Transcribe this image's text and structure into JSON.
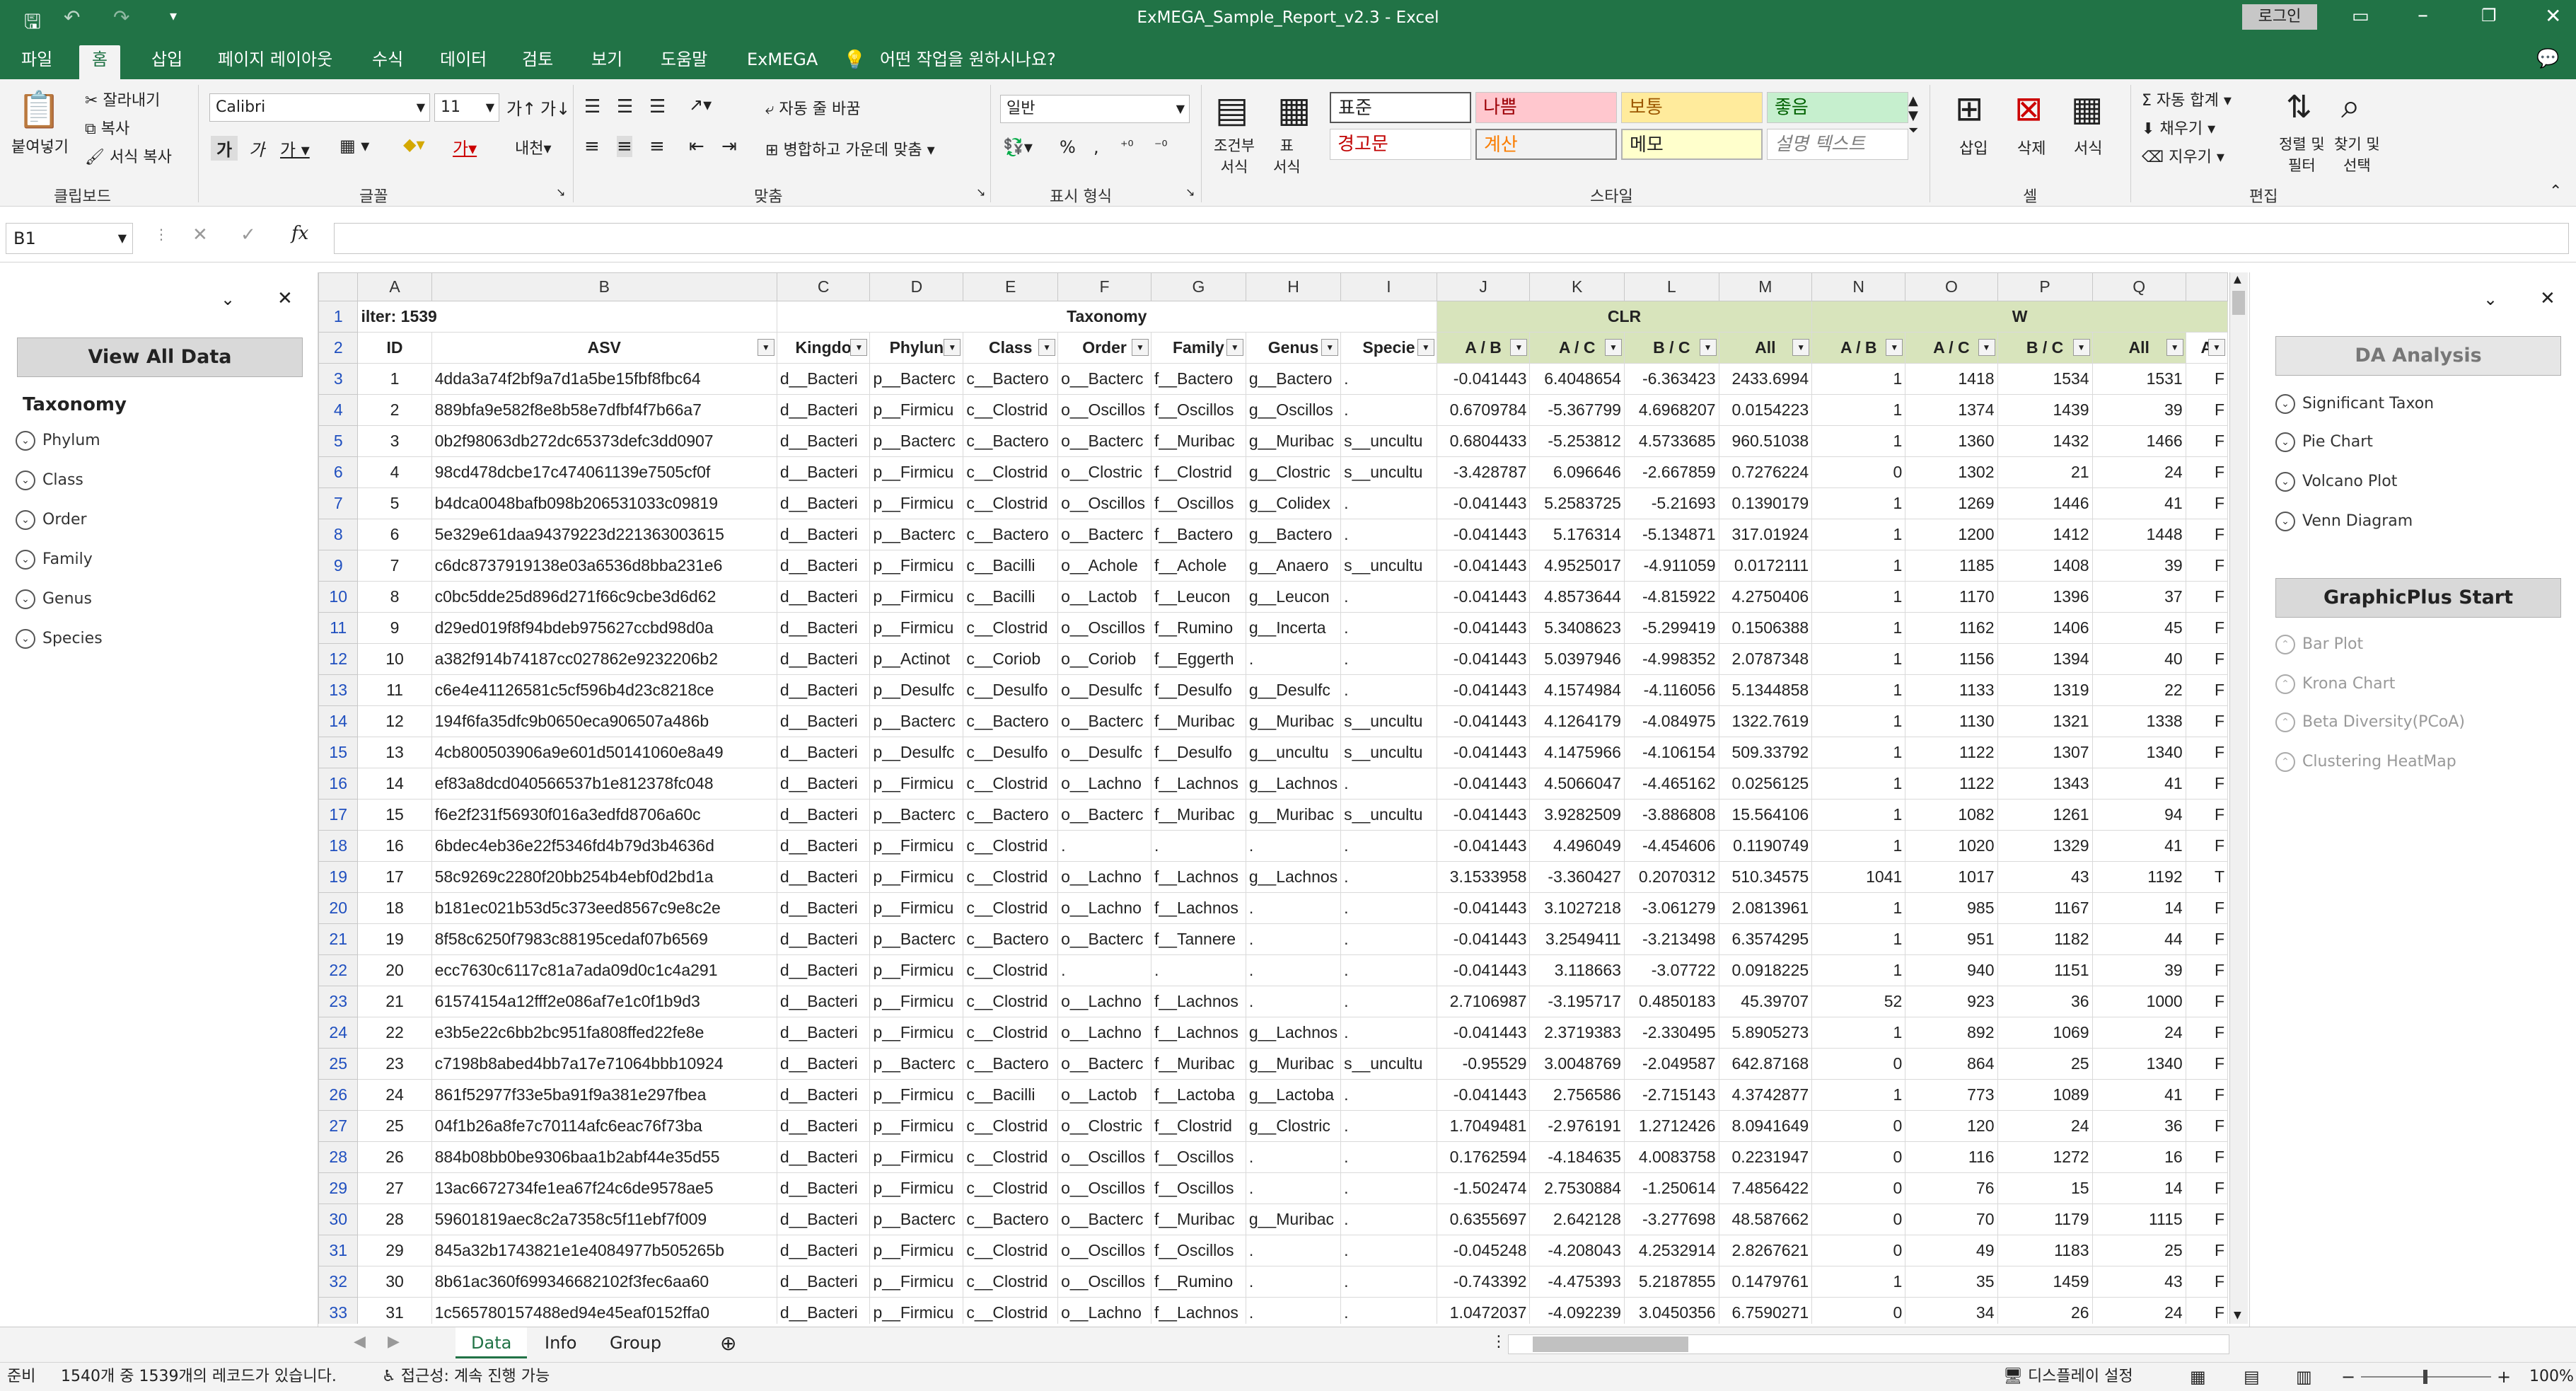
{
  "window": {
    "title": "ExMEGA_Sample_Report_v2.3  -  Excel",
    "login_label": "로그인"
  },
  "ribbon_tabs": [
    "파일",
    "홈",
    "삽입",
    "페이지 레이아웃",
    "수식",
    "데이터",
    "검토",
    "보기",
    "도움말",
    "ExMEGA",
    "어떤 작업을 원하시나요?"
  ],
  "ribbon": {
    "clipboard": {
      "paste": "붙여넣기",
      "cut": "잘라내기",
      "copy": "복사",
      "format_painter": "서식 복사",
      "label": "클립보드"
    },
    "font": {
      "name": "Calibri",
      "size": "11",
      "label": "글꼴"
    },
    "align": {
      "wrap": "자동 줄 바꿈",
      "merge": "병합하고 가운데 맞춤",
      "label": "맞춤"
    },
    "number": {
      "format": "일반",
      "label": "표시 형식"
    },
    "styles": {
      "cond": "조건부\n서식",
      "table": "표\n서식",
      "cells": [
        "표준",
        "나쁨",
        "보통",
        "좋음",
        "경고문",
        "계산",
        "메모",
        "설명 텍스트"
      ],
      "label": "스타일"
    },
    "cells": {
      "insert": "삽입",
      "delete": "삭제",
      "format": "서식",
      "label": "셀"
    },
    "edit": {
      "autosum": "자동 합계",
      "fill": "채우기",
      "clear": "지우기",
      "sort": "정렬 및\n필터",
      "find": "찾기 및\n선택",
      "label": "편집"
    }
  },
  "namebox": "B1",
  "left_pane": {
    "button": "View All Data",
    "section": "Taxonomy",
    "items": [
      "Phylum",
      "Class",
      "Order",
      "Family",
      "Genus",
      "Species"
    ]
  },
  "right_pane": {
    "button1": "DA Analysis",
    "items1": [
      "Significant Taxon",
      "Pie Chart",
      "Volcano Plot",
      "Venn Diagram"
    ],
    "button2": "GraphicPlus Start",
    "items2": [
      "Bar Plot",
      "Krona Chart",
      "Beta Diversity(PCoA)",
      "Clustering HeatMap"
    ]
  },
  "sheet": {
    "columns": [
      "A",
      "B",
      "C",
      "D",
      "E",
      "F",
      "G",
      "H",
      "I",
      "J",
      "K",
      "L",
      "M",
      "N",
      "O",
      "P",
      "Q",
      ""
    ],
    "row1": {
      "filter": "ilter: 1539",
      "taxonomy": "Taxonomy",
      "clr": "CLR",
      "w": "W"
    },
    "headers": [
      "ID",
      "ASV",
      "Kingdo",
      "Phylun",
      "Class",
      "Order",
      "Family",
      "Genus",
      "Specie",
      "A / B",
      "A / C",
      "B / C",
      "All",
      "A / B",
      "A / C",
      "B / C",
      "All",
      "A"
    ],
    "rows": [
      [
        "1",
        "4dda3a74f2bf9a7d1a5be15fbf8fbc64",
        "d__Bacteri",
        "p__Bacterc",
        "c__Bactero",
        "o__Bacterc",
        "f__Bactero",
        "g__Bactero",
        ".",
        "-0.041443",
        "6.4048654",
        "-6.363423",
        "2433.6994",
        "1",
        "1418",
        "1534",
        "1531",
        "F"
      ],
      [
        "2",
        "889bfa9e582f8e8b58e7dfbf4f7b66a7",
        "d__Bacteri",
        "p__Firmicu",
        "c__Clostrid",
        "o__Oscillos",
        "f__Oscillos",
        "g__Oscillos",
        ".",
        "0.6709784",
        "-5.367799",
        "4.6968207",
        "0.0154223",
        "1",
        "1374",
        "1439",
        "39",
        "F"
      ],
      [
        "3",
        "0b2f98063db272dc65373defc3dd0907",
        "d__Bacteri",
        "p__Bacterc",
        "c__Bactero",
        "o__Bacterc",
        "f__Muribac",
        "g__Muribac",
        "s__uncultu",
        "0.6804433",
        "-5.253812",
        "4.5733685",
        "960.51038",
        "1",
        "1360",
        "1432",
        "1466",
        "F"
      ],
      [
        "4",
        "98cd478dcbe17c474061139e7505cf0f",
        "d__Bacteri",
        "p__Firmicu",
        "c__Clostrid",
        "o__Clostric",
        "f__Clostrid",
        "g__Clostric",
        "s__uncultu",
        "-3.428787",
        "6.096646",
        "-2.667859",
        "0.7276224",
        "0",
        "1302",
        "21",
        "24",
        "F"
      ],
      [
        "5",
        "b4dca0048bafb098b206531033c09819",
        "d__Bacteri",
        "p__Firmicu",
        "c__Clostrid",
        "o__Oscillos",
        "f__Oscillos",
        "g__Colidex",
        ".",
        "-0.041443",
        "5.2583725",
        "-5.21693",
        "0.1390179",
        "1",
        "1269",
        "1446",
        "41",
        "F"
      ],
      [
        "6",
        "5e329e61daa94379223d221363003615",
        "d__Bacteri",
        "p__Bacterc",
        "c__Bactero",
        "o__Bacterc",
        "f__Bactero",
        "g__Bactero",
        ".",
        "-0.041443",
        "5.176314",
        "-5.134871",
        "317.01924",
        "1",
        "1200",
        "1412",
        "1448",
        "F"
      ],
      [
        "7",
        "c6dc8737919138e03a6536d8bba231e6",
        "d__Bacteri",
        "p__Firmicu",
        "c__Bacilli",
        "o__Achole",
        "f__Achole",
        "g__Anaero",
        "s__uncultu",
        "-0.041443",
        "4.9525017",
        "-4.911059",
        "0.0172111",
        "1",
        "1185",
        "1408",
        "39",
        "F"
      ],
      [
        "8",
        "c0bc5dde25d896d271f66c9cbe3d6d62",
        "d__Bacteri",
        "p__Firmicu",
        "c__Bacilli",
        "o__Lactob",
        "f__Leucon",
        "g__Leucon",
        ".",
        "-0.041443",
        "4.8573644",
        "-4.815922",
        "4.2750406",
        "1",
        "1170",
        "1396",
        "37",
        "F"
      ],
      [
        "9",
        "d29ed019f8f94bdeb975627ccbd98d0a",
        "d__Bacteri",
        "p__Firmicu",
        "c__Clostrid",
        "o__Oscillos",
        "f__Rumino",
        "g__Incerta",
        ".",
        "-0.041443",
        "5.3408623",
        "-5.299419",
        "0.1506388",
        "1",
        "1162",
        "1406",
        "45",
        "F"
      ],
      [
        "10",
        "a382f914b74187cc027862e9232206b2",
        "d__Bacteri",
        "p__Actinot",
        "c__Coriob",
        "o__Coriob",
        "f__Eggerth",
        ".",
        ".",
        "-0.041443",
        "5.0397946",
        "-4.998352",
        "2.0787348",
        "1",
        "1156",
        "1394",
        "40",
        "F"
      ],
      [
        "11",
        "c6e4e41126581c5cf596b4d23c8218ce",
        "d__Bacteri",
        "p__Desulfc",
        "c__Desulfo",
        "o__Desulfc",
        "f__Desulfo",
        "g__Desulfc",
        ".",
        "-0.041443",
        "4.1574984",
        "-4.116056",
        "5.1344858",
        "1",
        "1133",
        "1319",
        "22",
        "F"
      ],
      [
        "12",
        "194f6fa35dfc9b0650eca906507a486b",
        "d__Bacteri",
        "p__Bacterc",
        "c__Bactero",
        "o__Bacterc",
        "f__Muribac",
        "g__Muribac",
        "s__uncultu",
        "-0.041443",
        "4.1264179",
        "-4.084975",
        "1322.7619",
        "1",
        "1130",
        "1321",
        "1338",
        "F"
      ],
      [
        "13",
        "4cb800503906a9e601d50141060e8a49",
        "d__Bacteri",
        "p__Desulfc",
        "c__Desulfo",
        "o__Desulfc",
        "f__Desulfo",
        "g__uncultu",
        "s__uncultu",
        "-0.041443",
        "4.1475966",
        "-4.106154",
        "509.33792",
        "1",
        "1122",
        "1307",
        "1340",
        "F"
      ],
      [
        "14",
        "ef83a8dcd040566537b1e812378fc048",
        "d__Bacteri",
        "p__Firmicu",
        "c__Clostrid",
        "o__Lachno",
        "f__Lachnos",
        "g__Lachnos",
        ".",
        "-0.041443",
        "4.5066047",
        "-4.465162",
        "0.0256125",
        "1",
        "1122",
        "1343",
        "41",
        "F"
      ],
      [
        "15",
        "f6e2f231f56930f016a3edfd8706a60c",
        "d__Bacteri",
        "p__Bacterc",
        "c__Bactero",
        "o__Bacterc",
        "f__Muribac",
        "g__Muribac",
        "s__uncultu",
        "-0.041443",
        "3.9282509",
        "-3.886808",
        "15.564106",
        "1",
        "1082",
        "1261",
        "94",
        "F"
      ],
      [
        "16",
        "6bdec4eb36e22f5346fd4b79d3b4636d",
        "d__Bacteri",
        "p__Firmicu",
        "c__Clostrid",
        ".",
        ".",
        ".",
        ".",
        "-0.041443",
        "4.496049",
        "-4.454606",
        "0.1190749",
        "1",
        "1020",
        "1329",
        "41",
        "F"
      ],
      [
        "17",
        "58c9269c2280f20bb254b4ebf0d2bd1a",
        "d__Bacteri",
        "p__Firmicu",
        "c__Clostrid",
        "o__Lachno",
        "f__Lachnos",
        "g__Lachnos",
        ".",
        "3.1533958",
        "-3.360427",
        "0.2070312",
        "510.34575",
        "1041",
        "1017",
        "43",
        "1192",
        "T"
      ],
      [
        "18",
        "b181ec021b53d5c373eed8567c9e8c2e",
        "d__Bacteri",
        "p__Firmicu",
        "c__Clostrid",
        "o__Lachno",
        "f__Lachnos",
        ".",
        ".",
        "-0.041443",
        "3.1027218",
        "-3.061279",
        "2.0813961",
        "1",
        "985",
        "1167",
        "14",
        "F"
      ],
      [
        "19",
        "8f58c6250f7983c88195cedaf07b6569",
        "d__Bacteri",
        "p__Bacterc",
        "c__Bactero",
        "o__Bacterc",
        "f__Tannere",
        ".",
        ".",
        "-0.041443",
        "3.2549411",
        "-3.213498",
        "6.3574295",
        "1",
        "951",
        "1182",
        "44",
        "F"
      ],
      [
        "20",
        "ecc7630c6117c81a7ada09d0c1c4a291",
        "d__Bacteri",
        "p__Firmicu",
        "c__Clostrid",
        ".",
        ".",
        ".",
        ".",
        "-0.041443",
        "3.118663",
        "-3.07722",
        "0.0918225",
        "1",
        "940",
        "1151",
        "39",
        "F"
      ],
      [
        "21",
        "61574154a12fff2e086af7e1c0f1b9d3",
        "d__Bacteri",
        "p__Firmicu",
        "c__Clostrid",
        "o__Lachno",
        "f__Lachnos",
        ".",
        ".",
        "2.7106987",
        "-3.195717",
        "0.4850183",
        "45.39707",
        "52",
        "923",
        "36",
        "1000",
        "F"
      ],
      [
        "22",
        "e3b5e22c6bb2bc951fa808ffed22fe8e",
        "d__Bacteri",
        "p__Firmicu",
        "c__Clostrid",
        "o__Lachno",
        "f__Lachnos",
        "g__Lachnos",
        ".",
        "-0.041443",
        "2.3719383",
        "-2.330495",
        "5.8905273",
        "1",
        "892",
        "1069",
        "24",
        "F"
      ],
      [
        "23",
        "c7198b8abed4bb7a17e71064bbb10924",
        "d__Bacteri",
        "p__Bacterc",
        "c__Bactero",
        "o__Bacterc",
        "f__Muribac",
        "g__Muribac",
        "s__uncultu",
        "-0.95529",
        "3.0048769",
        "-2.049587",
        "642.87168",
        "0",
        "864",
        "25",
        "1340",
        "F"
      ],
      [
        "24",
        "861f52977f33e5ba91f9a381e297fbea",
        "d__Bacteri",
        "p__Firmicu",
        "c__Bacilli",
        "o__Lactob",
        "f__Lactoba",
        "g__Lactoba",
        ".",
        "-0.041443",
        "2.756586",
        "-2.715143",
        "4.3742877",
        "1",
        "773",
        "1089",
        "41",
        "F"
      ],
      [
        "25",
        "04f1b26a8fe7c70114afc6eac76f73ba",
        "d__Bacteri",
        "p__Firmicu",
        "c__Clostrid",
        "o__Clostric",
        "f__Clostrid",
        "g__Clostric",
        ".",
        "1.7049481",
        "-2.976191",
        "1.2712426",
        "8.0941649",
        "0",
        "120",
        "24",
        "36",
        "F"
      ],
      [
        "26",
        "884b08bb0be9306baa1b2abf44e35d55",
        "d__Bacteri",
        "p__Firmicu",
        "c__Clostrid",
        "o__Oscillos",
        "f__Oscillos",
        ".",
        ".",
        "0.1762594",
        "-4.184635",
        "4.0083758",
        "0.2231947",
        "0",
        "116",
        "1272",
        "16",
        "F"
      ],
      [
        "27",
        "13ac6672734fe1ea67f24c6de9578ae5",
        "d__Bacteri",
        "p__Firmicu",
        "c__Clostrid",
        "o__Oscillos",
        "f__Oscillos",
        ".",
        ".",
        "-1.502474",
        "2.7530884",
        "-1.250614",
        "7.4856422",
        "0",
        "76",
        "15",
        "14",
        "F"
      ],
      [
        "28",
        "59601819aec8c2a7358c5f11ebf7f009",
        "d__Bacteri",
        "p__Bacterc",
        "c__Bactero",
        "o__Bacterc",
        "f__Muribac",
        "g__Muribac",
        ".",
        "0.6355697",
        "2.642128",
        "-3.277698",
        "48.587662",
        "0",
        "70",
        "1179",
        "1115",
        "F"
      ],
      [
        "29",
        "845a32b1743821e1e4084977b505265b",
        "d__Bacteri",
        "p__Firmicu",
        "c__Clostrid",
        "o__Oscillos",
        "f__Oscillos",
        ".",
        ".",
        "-0.045248",
        "-4.208043",
        "4.2532914",
        "2.8267621",
        "0",
        "49",
        "1183",
        "25",
        "F"
      ],
      [
        "30",
        "8b61ac360f699346682102f3fec6aa60",
        "d__Bacteri",
        "p__Firmicu",
        "c__Clostrid",
        "o__Oscillos",
        "f__Rumino",
        ".",
        ".",
        "-0.743392",
        "-4.475393",
        "5.2187855",
        "0.1479761",
        "1",
        "35",
        "1459",
        "43",
        "F"
      ],
      [
        "31",
        "1c565780157488ed94e45eaf0152ffa0",
        "d__Bacteri",
        "p__Firmicu",
        "c__Clostrid",
        "o__Lachno",
        "f__Lachnos",
        ".",
        ".",
        "1.0472037",
        "-4.092239",
        "3.0450356",
        "6.7590271",
        "0",
        "34",
        "26",
        "24",
        "F"
      ]
    ]
  },
  "sheet_tabs": [
    "Data",
    "Info",
    "Group"
  ],
  "status": {
    "ready": "준비",
    "records": "1540개 중 1539개의 레코드가 있습니다.",
    "accessibility": "접근성: 계속 진행 가능",
    "display": "디스플레이 설정",
    "zoom": "100%"
  }
}
